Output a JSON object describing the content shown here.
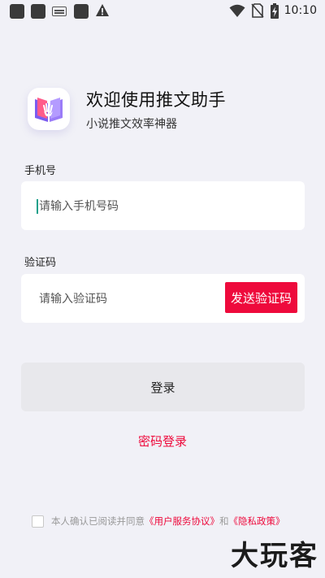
{
  "status_bar": {
    "time": "10:10",
    "icons": [
      "app-square-icon",
      "app-square-icon",
      "keyboard-icon",
      "app-square-icon",
      "warning-icon",
      "wifi-icon",
      "no-sim-icon",
      "battery-charging-icon"
    ]
  },
  "header": {
    "title": "欢迎使用推文助手",
    "subtitle": "小说推文效率神器"
  },
  "form": {
    "phone_label": "手机号",
    "phone_placeholder": "请输入手机号码",
    "phone_value": "",
    "code_label": "验证码",
    "code_placeholder": "请输入验证码",
    "code_value": "",
    "send_code_label": "发送验证码",
    "login_label": "登录",
    "password_login_label": "密码登录"
  },
  "agreement": {
    "checked": false,
    "prefix": "本人确认已阅读并同意",
    "user_agreement": "《用户服务协议》",
    "conjunction": "和",
    "privacy_policy": "《隐私政策》"
  },
  "watermark": "大玩客",
  "colors": {
    "background": "#f1f1f7",
    "accent_red": "#ee0a3c",
    "button_gray": "#e8e8ec",
    "logo_purple": "#7b5cf0",
    "logo_pink": "#ff5c8a"
  }
}
